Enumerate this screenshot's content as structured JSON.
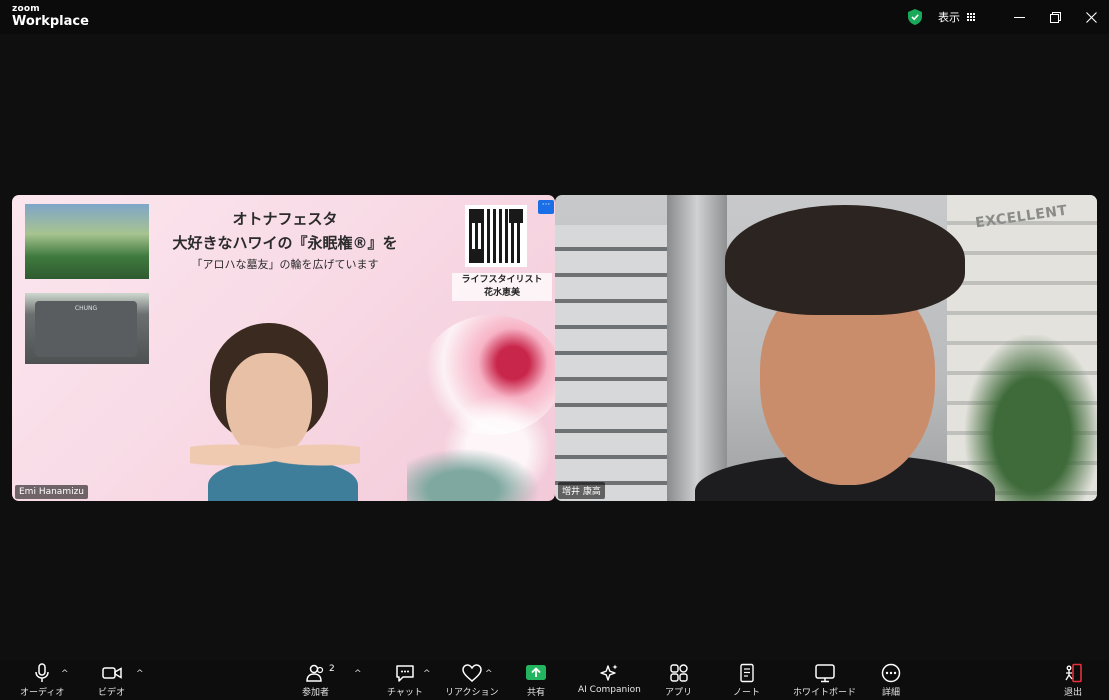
{
  "window": {
    "brand_small": "zoom",
    "brand_large": "Workplace",
    "view_label": "表示"
  },
  "colors": {
    "security_green": "#1aa85a",
    "share_green": "#22b45e",
    "leave_red": "#e5303a",
    "menu_blue": "#1a6fe6"
  },
  "tiles": [
    {
      "participant_name": "Emi Hanamizu",
      "slide": {
        "title_line1": "オトナフェスタ",
        "title_line2": "大好きなハワイの『永眠権®』を",
        "title_line3": "「アロハな墓友」の輪を広げています",
        "stylist_line1": "ライフスタイリスト",
        "stylist_line2": "花水恵美",
        "stone_text": "CHUNG",
        "menu_dots": "···"
      }
    },
    {
      "participant_name": "増井 康高",
      "background_sign": "EXCELLENT"
    }
  ],
  "toolbar": {
    "audio": "オーディオ",
    "video": "ビデオ",
    "participants": "参加者",
    "participants_count": "2",
    "chat": "チャット",
    "reactions": "リアクション",
    "share": "共有",
    "ai_companion": "AI Companion",
    "apps": "アプリ",
    "notes": "ノート",
    "whiteboard": "ホワイトボード",
    "more": "詳細",
    "leave": "退出",
    "caret": "^"
  }
}
